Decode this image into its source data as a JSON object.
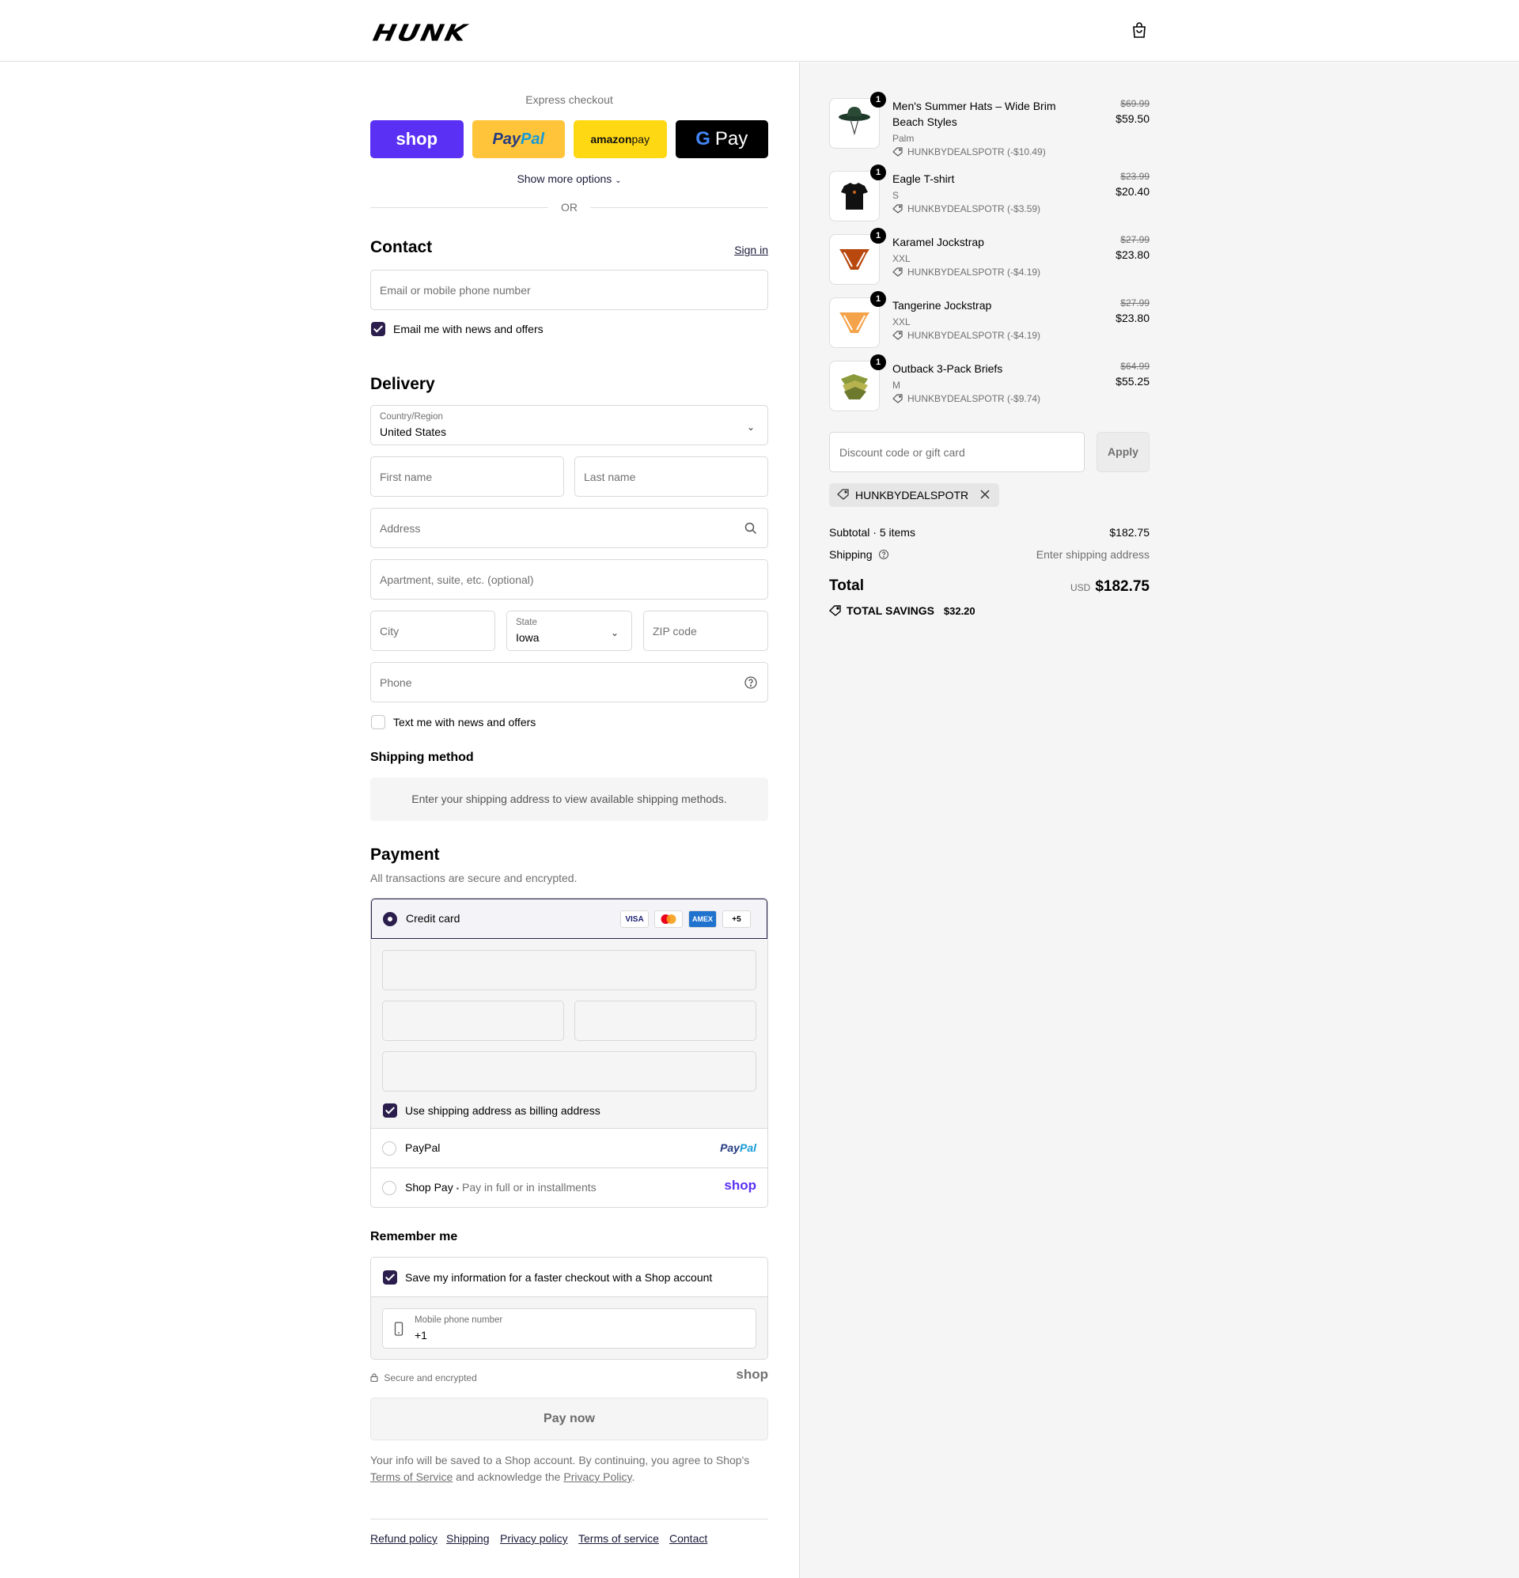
{
  "header": {
    "logo": "HUNK",
    "cart_icon": "shopping-bag-icon"
  },
  "express": {
    "title": "Express checkout",
    "buttons": {
      "shop": "shop",
      "paypal_a": "Pay",
      "paypal_b": "Pal",
      "amazon_a": "amazon",
      "amazon_b": " pay",
      "google_g": "G",
      "google_pay": "Pay"
    },
    "show_more": "Show more options",
    "or": "OR"
  },
  "contact": {
    "heading": "Contact",
    "sign_in": "Sign in",
    "email_placeholder": "Email or mobile phone number",
    "newsletter_label": "Email me with news and offers",
    "newsletter_checked": true
  },
  "delivery": {
    "heading": "Delivery",
    "country_label": "Country/Region",
    "country_value": "United States",
    "first_name": "First name",
    "last_name": "Last name",
    "address": "Address",
    "apartment": "Apartment, suite, etc. (optional)",
    "city": "City",
    "state_label": "State",
    "state_value": "Iowa",
    "zip": "ZIP code",
    "phone": "Phone",
    "sms_label": "Text me with news and offers",
    "sms_checked": false
  },
  "shipping_method": {
    "heading": "Shipping method",
    "notice": "Enter your shipping address to view available shipping methods."
  },
  "payment": {
    "heading": "Payment",
    "subtitle": "All transactions are secure and encrypted.",
    "credit_card": "Credit card",
    "card_badges": [
      "VISA",
      "",
      "AMEX",
      "+5"
    ],
    "billing_label": "Use shipping address as billing address",
    "paypal_label": "PayPal",
    "paypal_logo_a": "Pay",
    "paypal_logo_b": "Pal",
    "shoppay_label": "Shop Pay",
    "shoppay_sep": "•",
    "shoppay_sub": "Pay in full or in installments",
    "shoppay_logo": "shop"
  },
  "remember": {
    "heading": "Remember me",
    "save_label": "Save my information for a faster checkout with a Shop account",
    "phone_label": "Mobile phone number",
    "phone_value": "+1",
    "secure": "Secure and encrypted",
    "shop_logo": "shop"
  },
  "pay_now": "Pay now",
  "legal": {
    "line1": "Your info will be saved to a Shop account. By continuing, you agree to Shop's",
    "terms": "Terms of Service",
    "mid": " and acknowledge the ",
    "privacy": "Privacy Policy",
    "end": "."
  },
  "footer": [
    "Refund policy",
    "Shipping",
    "Privacy policy",
    "Terms of service",
    "Contact"
  ],
  "cart": {
    "items": [
      {
        "name": "Men's Summer Hats – Wide Brim Beach Styles",
        "variant": "Palm",
        "discount": "HUNKBYDEALSPOTR (-$10.49)",
        "old": "$69.99",
        "price": "$59.50",
        "qty": "1"
      },
      {
        "name": "Eagle T-shirt",
        "variant": "S",
        "discount": "HUNKBYDEALSPOTR (-$3.59)",
        "old": "$23.99",
        "price": "$20.40",
        "qty": "1"
      },
      {
        "name": "Karamel Jockstrap",
        "variant": "XXL",
        "discount": "HUNKBYDEALSPOTR (-$4.19)",
        "old": "$27.99",
        "price": "$23.80",
        "qty": "1"
      },
      {
        "name": "Tangerine Jockstrap",
        "variant": "XXL",
        "discount": "HUNKBYDEALSPOTR (-$4.19)",
        "old": "$27.99",
        "price": "$23.80",
        "qty": "1"
      },
      {
        "name": "Outback 3-Pack Briefs",
        "variant": "M",
        "discount": "HUNKBYDEALSPOTR (-$9.74)",
        "old": "$64.99",
        "price": "$55.25",
        "qty": "1"
      }
    ],
    "discount_placeholder": "Discount code or gift card",
    "apply": "Apply",
    "applied_code": "HUNKBYDEALSPOTR",
    "subtotal_label": "Subtotal · 5 items",
    "subtotal": "$182.75",
    "shipping_label": "Shipping",
    "shipping_value": "Enter shipping address",
    "total_label": "Total",
    "currency": "USD",
    "total": "$182.75",
    "savings_label": "TOTAL SAVINGS",
    "savings": "$32.20"
  },
  "colors": {
    "accent": "#2b1e4c",
    "shop_purple": "#5a31f4",
    "paypal_yellow": "#ffc439",
    "amazon_yellow": "#ffd814",
    "summary_bg": "#f5f5f5"
  }
}
